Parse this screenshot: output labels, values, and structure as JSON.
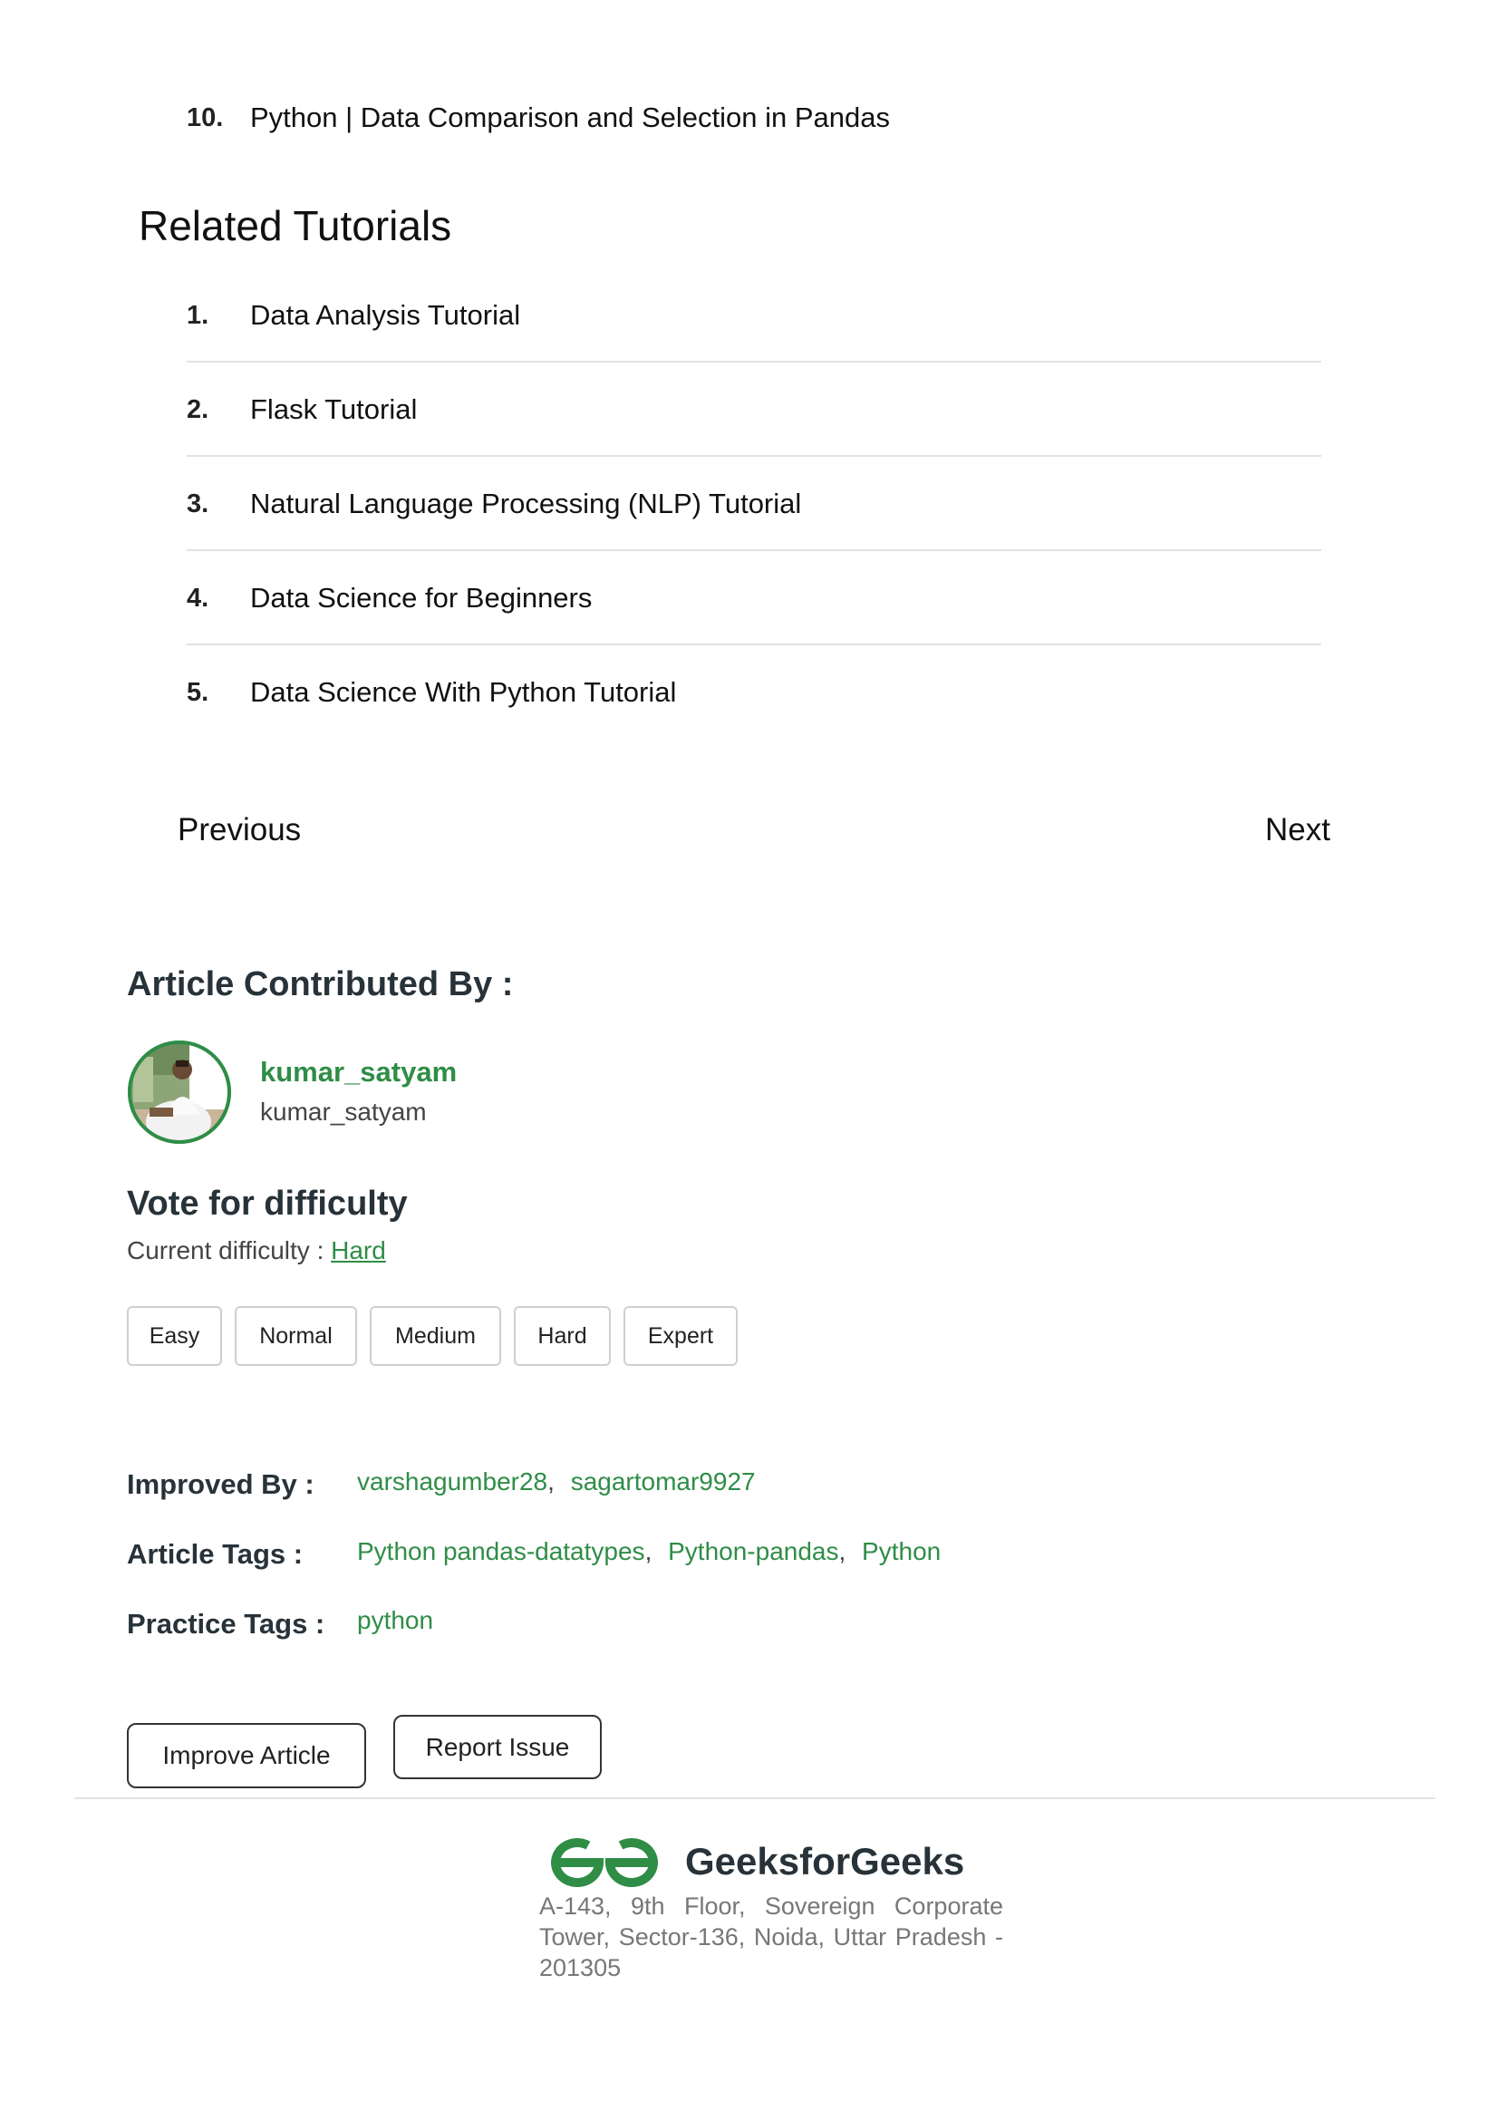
{
  "top_item": {
    "number": "10.",
    "text": "Python | Data Comparison and Selection in Pandas"
  },
  "related": {
    "title": "Related Tutorials",
    "items": [
      {
        "number": "1.",
        "text": "Data Analysis Tutorial"
      },
      {
        "number": "2.",
        "text": "Flask Tutorial"
      },
      {
        "number": "3.",
        "text": "Natural Language Processing (NLP) Tutorial"
      },
      {
        "number": "4.",
        "text": "Data Science for Beginners"
      },
      {
        "number": "5.",
        "text": "Data Science With Python Tutorial"
      }
    ]
  },
  "nav": {
    "previous": "Previous",
    "next": "Next"
  },
  "contributor": {
    "heading": "Article Contributed By :",
    "name": "kumar_satyam",
    "handle": "kumar_satyam"
  },
  "difficulty": {
    "heading": "Vote for difficulty",
    "current_label": "Current difficulty :",
    "current_value": "Hard",
    "options": [
      "Easy",
      "Normal",
      "Medium",
      "Hard",
      "Expert"
    ]
  },
  "meta": {
    "improved_by_label": "Improved By :",
    "improved_by": [
      "varshagumber28",
      "sagartomar9927"
    ],
    "article_tags_label": "Article Tags :",
    "article_tags": [
      "Python pandas-datatypes",
      "Python-pandas",
      "Python"
    ],
    "practice_tags_label": "Practice Tags :",
    "practice_tags": [
      "python"
    ],
    "separator": ","
  },
  "actions": {
    "improve": "Improve Article",
    "report": "Report Issue"
  },
  "footer": {
    "brand": "GeeksforGeeks",
    "address": "A-143, 9th Floor, Sovereign Corporate Tower, Sector-136, Noida, Uttar Pradesh - 201305"
  },
  "colors": {
    "accent": "#2f8d46",
    "heading": "#273239",
    "rule": "#e2e2e2"
  },
  "icons": {
    "logo": "geeksforgeeks-logo-icon",
    "avatar": "user-avatar"
  }
}
